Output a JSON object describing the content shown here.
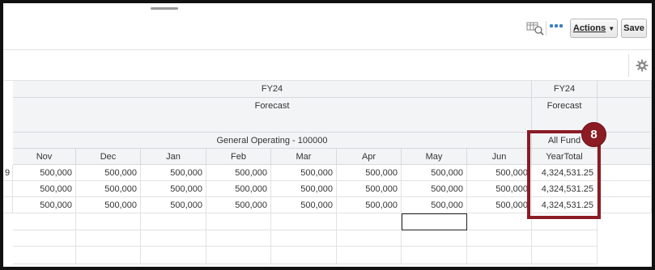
{
  "toolbar": {
    "search_icon": "search-grid-icon",
    "more_icon": "more-dots-icon",
    "actions_label": "Actions",
    "save_label": "Save"
  },
  "subbar": {
    "settings_icon": "gear-icon"
  },
  "grid": {
    "pov": {
      "year_main": "FY24",
      "scenario_main": "Forecast",
      "entity_main": "General Operating - 100000",
      "year_total": "FY24",
      "scenario_total": "Forecast",
      "entity_total": "All Fund"
    },
    "partial_first_cell": "9",
    "columns": [
      "Nov",
      "Dec",
      "Jan",
      "Feb",
      "Mar",
      "Apr",
      "May",
      "Jun",
      "YearTotal"
    ],
    "rows": [
      [
        "500,000",
        "500,000",
        "500,000",
        "500,000",
        "500,000",
        "500,000",
        "500,000",
        "500,000",
        "4,324,531.25"
      ],
      [
        "500,000",
        "500,000",
        "500,000",
        "500,000",
        "500,000",
        "500,000",
        "500,000",
        "500,000",
        "4,324,531.25"
      ],
      [
        "500,000",
        "500,000",
        "500,000",
        "500,000",
        "500,000",
        "500,000",
        "500,000",
        "500,000",
        "4,324,531.25"
      ]
    ]
  },
  "callout": {
    "number": "8",
    "color": "#8b1c24"
  }
}
